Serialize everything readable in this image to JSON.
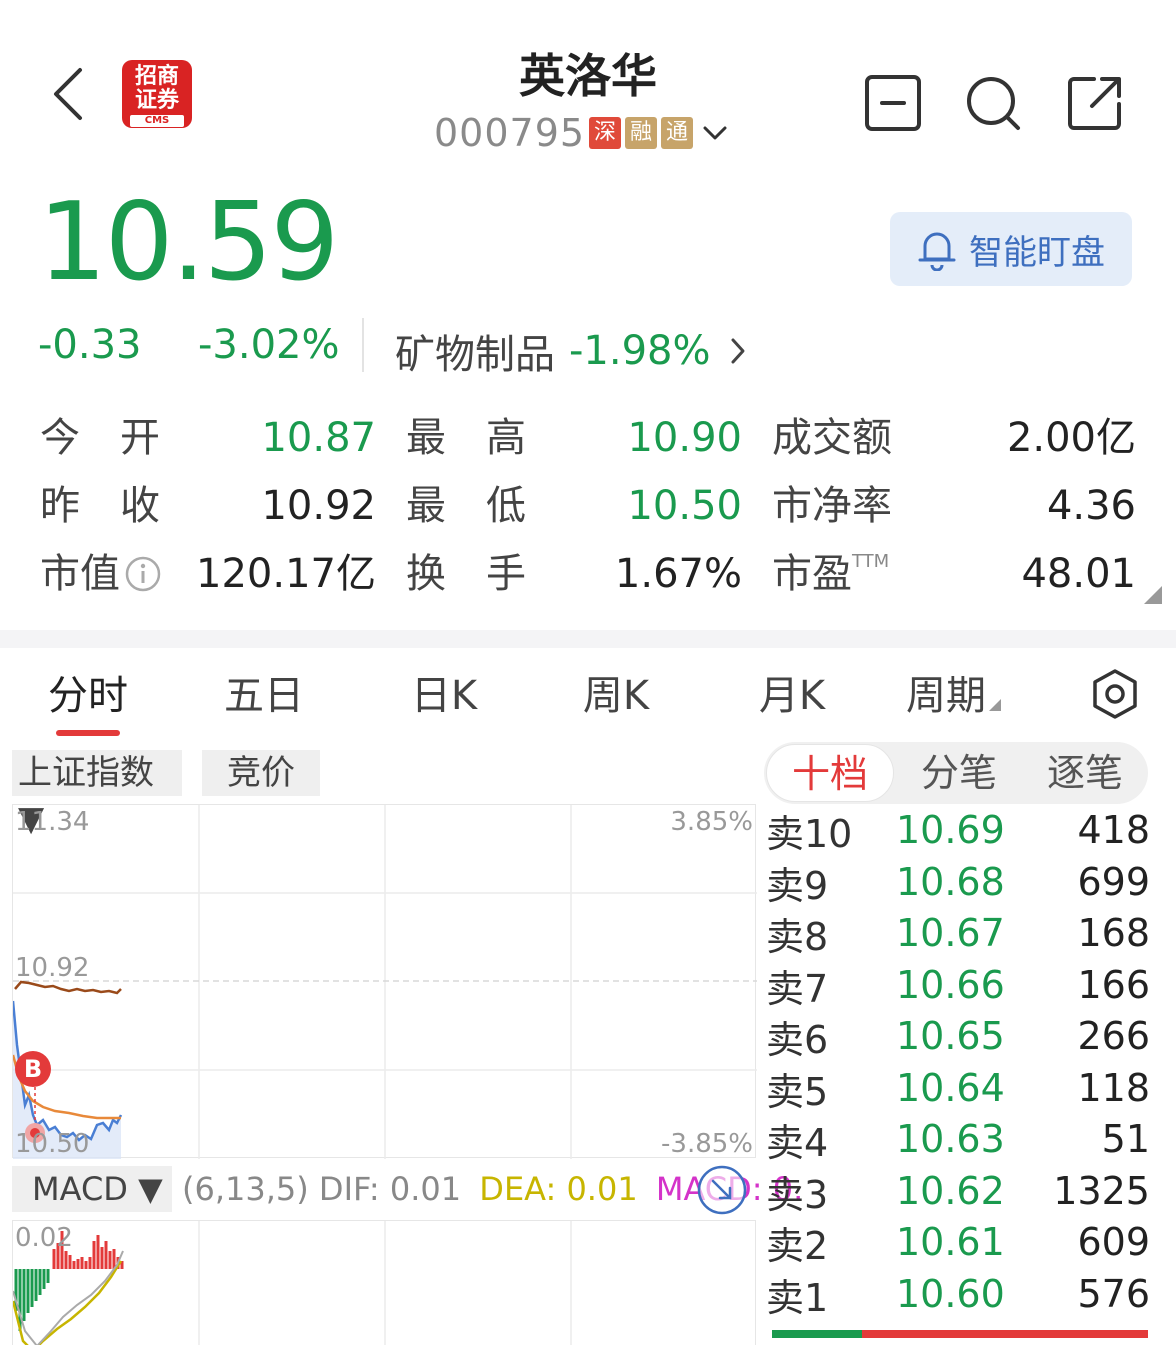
{
  "header": {
    "title": "英洛华",
    "code": "000795",
    "tags": [
      "深",
      "融",
      "通"
    ],
    "logo_text_line1": "招商",
    "logo_text_line2": "证券",
    "logo_sub": "CMS"
  },
  "quote": {
    "price": "10.59",
    "change": "-0.33",
    "change_pct": "-3.02%",
    "industry_name": "矿物制品",
    "industry_pct": "-1.98%",
    "smart_button": "智能盯盘"
  },
  "stats": {
    "open_label": "今　开",
    "open_value": "10.87",
    "high_label": "最　高",
    "high_value": "10.90",
    "amount_label": "成交额",
    "amount_value": "2.00亿",
    "prev_label": "昨　收",
    "prev_value": "10.92",
    "low_label": "最　低",
    "low_value": "10.50",
    "pb_label": "市净率",
    "pb_value": "4.36",
    "mcap_label": "市值",
    "mcap_value": "120.17亿",
    "turnover_label": "换　手",
    "turnover_value": "1.67%",
    "pe_label": "市盈",
    "pe_sup": "TTM",
    "pe_value": "48.01"
  },
  "tabs": [
    "分时",
    "五日",
    "日K",
    "周K",
    "月K",
    "周期"
  ],
  "chart_controls": {
    "index_select": "上证指数▼",
    "auction": "竞价",
    "y_top_left": "11.34",
    "y_top_right": "3.85%",
    "y_mid": "10.92",
    "y_bottom_left": "10.50",
    "y_bottom_right": "-3.85%",
    "marker": "B"
  },
  "macd": {
    "select": "MACD ▼",
    "params": "(6,13,5)",
    "dif": "DIF: 0.01",
    "dea": "DEA: 0.01",
    "macd": "MACD: 0.",
    "y_top": "0.02"
  },
  "orderbook": {
    "tabs": [
      "十档",
      "分笔",
      "逐笔"
    ],
    "rows": [
      {
        "label": "卖10",
        "price": "10.69",
        "vol": "418"
      },
      {
        "label": "卖9",
        "price": "10.68",
        "vol": "699"
      },
      {
        "label": "卖8",
        "price": "10.67",
        "vol": "168"
      },
      {
        "label": "卖7",
        "price": "10.66",
        "vol": "166"
      },
      {
        "label": "卖6",
        "price": "10.65",
        "vol": "266"
      },
      {
        "label": "卖5",
        "price": "10.64",
        "vol": "118"
      },
      {
        "label": "卖4",
        "price": "10.63",
        "vol": "51"
      },
      {
        "label": "卖3",
        "price": "10.62",
        "vol": "1325"
      },
      {
        "label": "卖2",
        "price": "10.61",
        "vol": "609"
      },
      {
        "label": "卖1",
        "price": "10.60",
        "vol": "576"
      }
    ],
    "buy_sell_ratio": 0.24
  },
  "colors": {
    "down": "#1a9a4e",
    "up": "#e33a3a",
    "price_line": "#4a7fd4",
    "avg_line": "#e8893a",
    "index_line": "#9a4a1a"
  }
}
